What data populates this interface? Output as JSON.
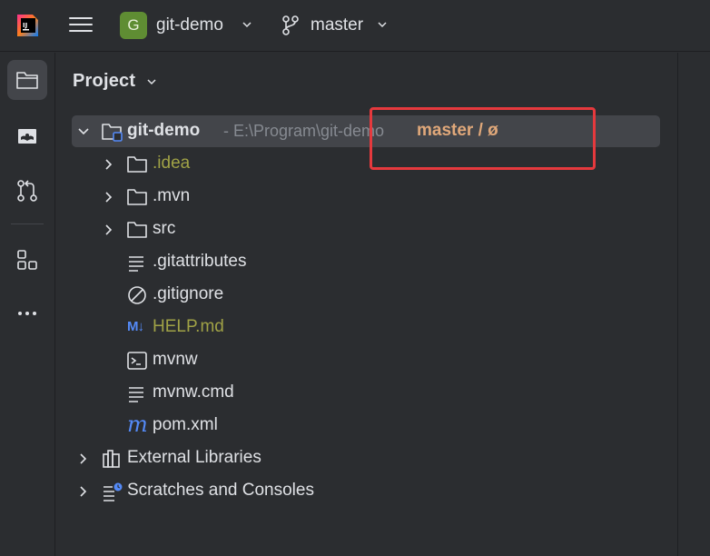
{
  "window": {
    "project_badge": "G",
    "project_name": "git-demo",
    "branch": "master"
  },
  "toolstrip": {
    "items": [
      {
        "name": "project",
        "icon": "folder-icon",
        "active": true
      },
      {
        "name": "learn",
        "icon": "learn-icon",
        "active": false
      },
      {
        "name": "commit",
        "icon": "vcs-icon",
        "active": false
      },
      {
        "name": "structure",
        "icon": "structure-icon",
        "active": false
      },
      {
        "name": "more",
        "icon": "more-icon",
        "active": false
      }
    ]
  },
  "panel": {
    "title": "Project",
    "root": {
      "label": "git-demo",
      "path": "- E:\\Program\\git-demo",
      "branch_info": "master / ø"
    },
    "children": [
      {
        "label": ".idea",
        "icon": "folder-icon",
        "expandable": true,
        "color": "olive"
      },
      {
        "label": ".mvn",
        "icon": "folder-icon",
        "expandable": true,
        "color": "default"
      },
      {
        "label": "src",
        "icon": "folder-icon",
        "expandable": true,
        "color": "default"
      },
      {
        "label": ".gitattributes",
        "icon": "text-file-icon",
        "expandable": false,
        "color": "default"
      },
      {
        "label": ".gitignore",
        "icon": "ignore-file-icon",
        "expandable": false,
        "color": "default"
      },
      {
        "label": "HELP.md",
        "icon": "markdown-icon",
        "icon_text": "M↓",
        "expandable": false,
        "color": "olive"
      },
      {
        "label": "mvnw",
        "icon": "terminal-file-icon",
        "expandable": false,
        "color": "default"
      },
      {
        "label": "mvnw.cmd",
        "icon": "text-file-icon",
        "expandable": false,
        "color": "default"
      },
      {
        "label": "pom.xml",
        "icon": "maven-icon",
        "icon_text": "m",
        "expandable": false,
        "color": "default"
      }
    ],
    "external_libraries": "External Libraries",
    "scratches": "Scratches and Consoles"
  },
  "colors": {
    "background": "#2b2d30",
    "selection": "#43454a",
    "text": "#dfe1e5",
    "olive_text": "#a0a246",
    "branch_text": "#e0a87a",
    "path_text": "#868a91",
    "annotation": "#e5393d",
    "badge": "#5f8d33"
  }
}
